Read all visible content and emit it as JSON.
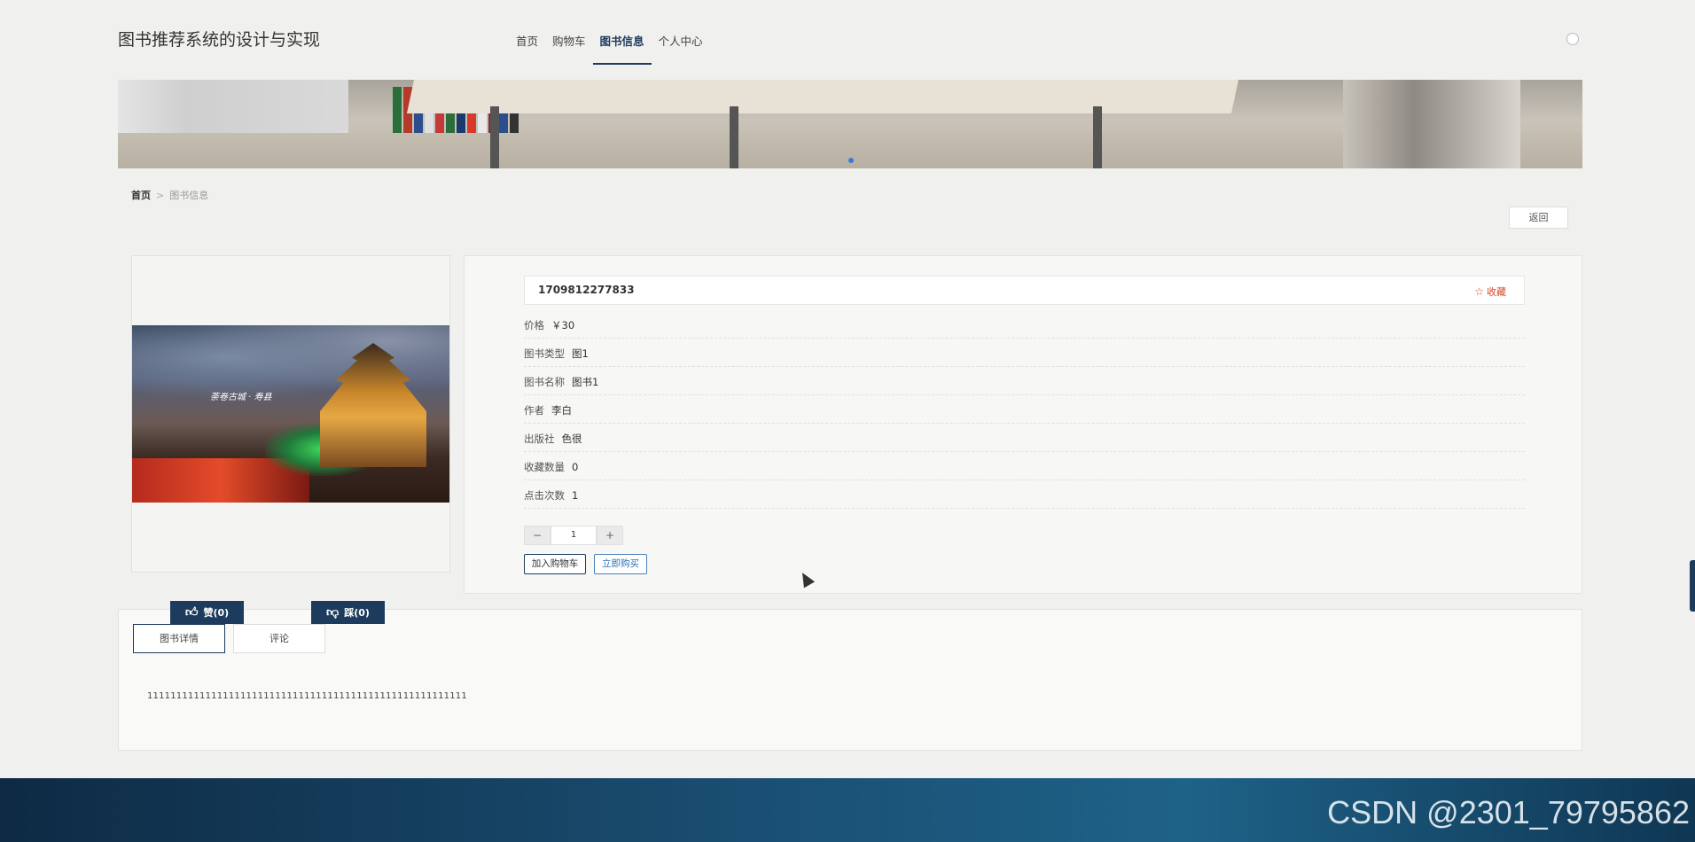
{
  "header": {
    "site_title": "图书推荐系统的设计与实现",
    "nav": [
      {
        "label": "首页"
      },
      {
        "label": "购物车"
      },
      {
        "label": "图书信息"
      },
      {
        "label": "个人中心"
      }
    ],
    "active_nav": "图书信息"
  },
  "breadcrumb": {
    "home": "首页",
    "separator": ">",
    "current": "图书信息"
  },
  "back_button": "返回",
  "book_image": {
    "caption": "荼卷古城 · 寿县"
  },
  "book": {
    "code": "1709812277833",
    "favorite_label": "收藏",
    "fields": [
      {
        "label": "价格",
        "value": "￥30"
      },
      {
        "label": "图书类型",
        "value": "图1"
      },
      {
        "label": "图书名称",
        "value": "图书1"
      },
      {
        "label": "作者",
        "value": "李白"
      },
      {
        "label": "出版社",
        "value": "色很"
      },
      {
        "label": "收藏数量",
        "value": "0"
      },
      {
        "label": "点击次数",
        "value": "1"
      }
    ]
  },
  "quantity": {
    "minus": "−",
    "value": "1",
    "plus": "+"
  },
  "actions": {
    "add_to_cart": "加入购物车",
    "buy_now": "立即购买"
  },
  "votes": {
    "like_label": "赞(0)",
    "dislike_label": "踩(0)"
  },
  "tabs": [
    {
      "label": "图书详情"
    },
    {
      "label": "评论"
    }
  ],
  "detail_text": "1111111111111111111111111111111111111111111111111111111",
  "footer": {
    "watermark": "CSDN @2301_79795862"
  },
  "colors": {
    "primary": "#1d3b5c",
    "favorite": "#d9442a",
    "buy_link": "#2d6fb0"
  }
}
